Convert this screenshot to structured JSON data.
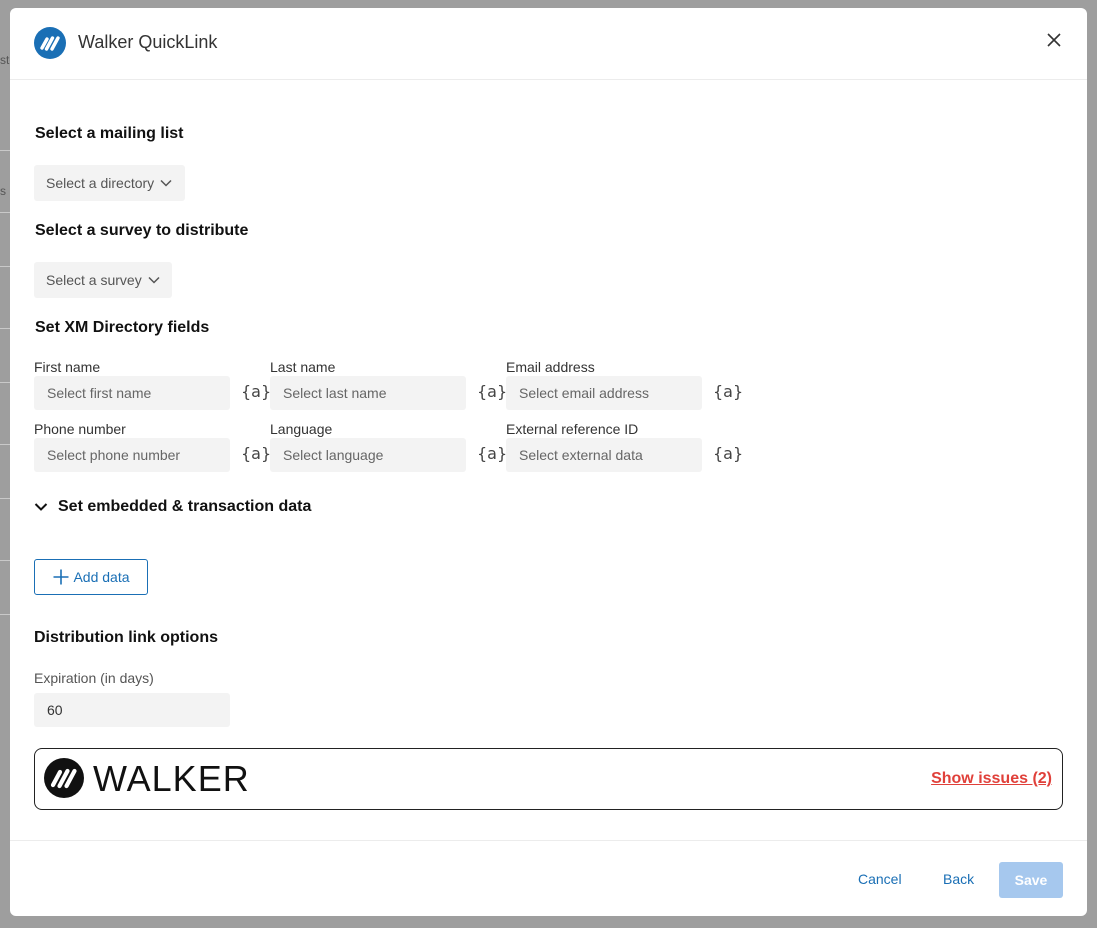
{
  "backdrop": {
    "fragment_1": "sto",
    "fragment_2": "s"
  },
  "dialog": {
    "title": "Walker QuickLink"
  },
  "mailing_list": {
    "heading": "Select a mailing list",
    "dropdown": "Select a directory"
  },
  "survey": {
    "heading": "Select a survey to distribute",
    "dropdown": "Select a survey"
  },
  "xm_fields": {
    "heading": "Set XM Directory fields",
    "piped_text_glyph": "{a}",
    "fields": [
      {
        "label": "First name",
        "placeholder": "Select first name"
      },
      {
        "label": "Last name",
        "placeholder": "Select last name"
      },
      {
        "label": "Email address",
        "placeholder": "Select email address"
      },
      {
        "label": "Phone number",
        "placeholder": "Select phone number"
      },
      {
        "label": "Language",
        "placeholder": "Select language"
      },
      {
        "label": "External reference ID",
        "placeholder": "Select external data"
      }
    ]
  },
  "embedded": {
    "heading": "Set embedded & transaction data",
    "expanded": true,
    "add_button": "Add data"
  },
  "link_options": {
    "heading": "Distribution link options",
    "expiration_label": "Expiration (in days)",
    "expiration_value": "60"
  },
  "walker_bar": {
    "brand": "WALKER",
    "issues_link": "Show issues (2)"
  },
  "footer": {
    "cancel": "Cancel",
    "back": "Back",
    "save": "Save",
    "save_disabled": true
  },
  "colors": {
    "accent": "#1a6fb5",
    "issues": "#e0403a",
    "save_disabled_bg": "#a6c8ee"
  }
}
